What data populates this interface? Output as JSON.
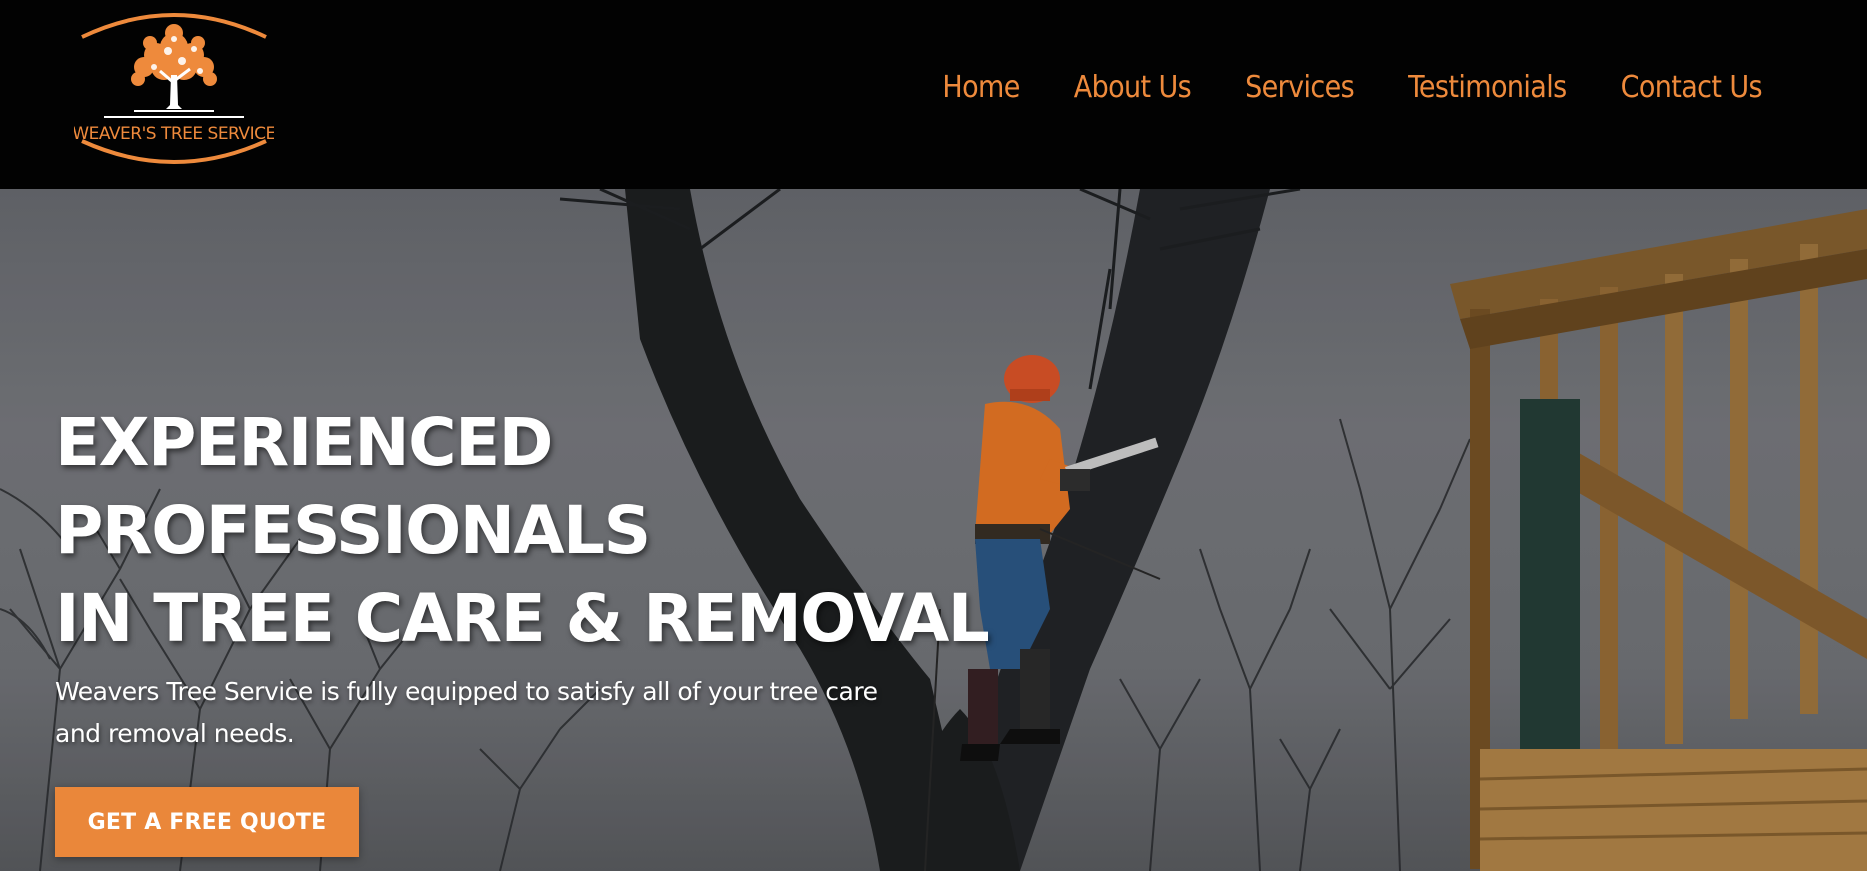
{
  "brand": {
    "logo_text": "WEAVER'S TREE SERVICE",
    "accent_color": "#ee8a3c"
  },
  "nav": {
    "items": [
      {
        "label": "Home"
      },
      {
        "label": "About Us"
      },
      {
        "label": "Services"
      },
      {
        "label": "Testimonials"
      },
      {
        "label": "Contact Us"
      }
    ]
  },
  "hero": {
    "headline_lines": [
      "EXPERIENCED",
      "PROFESSIONALS",
      "IN TREE CARE & REMOVAL"
    ],
    "subtext": "Weavers Tree Service is fully equipped to satisfy all of your tree care and removal needs.",
    "cta_label": "GET A FREE QUOTE",
    "cta_color": "#ea873a",
    "background_subject": "arborist-in-tree-with-chainsaw"
  }
}
